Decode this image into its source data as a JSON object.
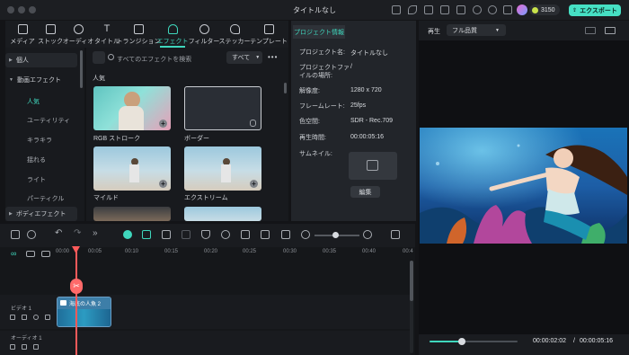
{
  "window": {
    "title": "タイトルなし"
  },
  "account": {
    "credits": "3150",
    "export_label": "エクスポート"
  },
  "tabs": [
    {
      "label": "メディア",
      "icon": "media-icon"
    },
    {
      "label": "ストック",
      "icon": "stock-icon"
    },
    {
      "label": "オーディオ",
      "icon": "audio-icon"
    },
    {
      "label": "タイトル",
      "icon": "title-icon"
    },
    {
      "label": "トランジション",
      "icon": "transition-icon"
    },
    {
      "label": "エフェクト",
      "icon": "effects-icon",
      "active": true
    },
    {
      "label": "フィルター",
      "icon": "filter-icon"
    },
    {
      "label": "ステッカー",
      "icon": "sticker-icon"
    },
    {
      "label": "テンプレート",
      "icon": "template-icon"
    }
  ],
  "sidebar": {
    "items": [
      {
        "label": "個人"
      },
      {
        "label": "動画エフェクト"
      },
      {
        "label": "ボディエフェクト"
      }
    ],
    "sub_items": [
      "人気",
      "ユーティリティ",
      "キラキラ",
      "揺れる",
      "ライト",
      "パーティクル"
    ]
  },
  "effects": {
    "search_placeholder": "すべてのエフェクトを検索",
    "filter_value": "すべて",
    "section": "人気",
    "items": [
      {
        "label": "RGB ストローク"
      },
      {
        "label": "ボーダー"
      },
      {
        "label": "マイルド"
      },
      {
        "label": "エクストリーム"
      }
    ]
  },
  "project_info": {
    "tab": "プロジェクト情報",
    "rows": [
      {
        "key": "プロジェクト名:",
        "value": "タイトルなし"
      },
      {
        "key": "プロジェクトファイルの場所:",
        "value": "/"
      },
      {
        "key": "解像度:",
        "value": "1280 x 720"
      },
      {
        "key": "フレームレート:",
        "value": "25fps"
      },
      {
        "key": "色空間:",
        "value": "SDR - Rec.709"
      },
      {
        "key": "再生時間:",
        "value": "00:00:05:16"
      },
      {
        "key": "サムネイル:",
        "value": ""
      }
    ],
    "edit_label": "編集"
  },
  "preview": {
    "label": "再生",
    "quality": "フル品質",
    "current_time": "00:00:02:02",
    "total_time": "00:00:05:16",
    "progress": 0.37
  },
  "timeline": {
    "ruler": [
      "00:00",
      "00:05",
      "00:10",
      "00:15",
      "00:20",
      "00:25",
      "00:30",
      "00:35",
      "00:40",
      "00:4"
    ],
    "tracks": [
      {
        "label": "ビデオ 1"
      },
      {
        "label": "オーディオ 1"
      }
    ],
    "clip_label": "海底の人魚 2"
  }
}
